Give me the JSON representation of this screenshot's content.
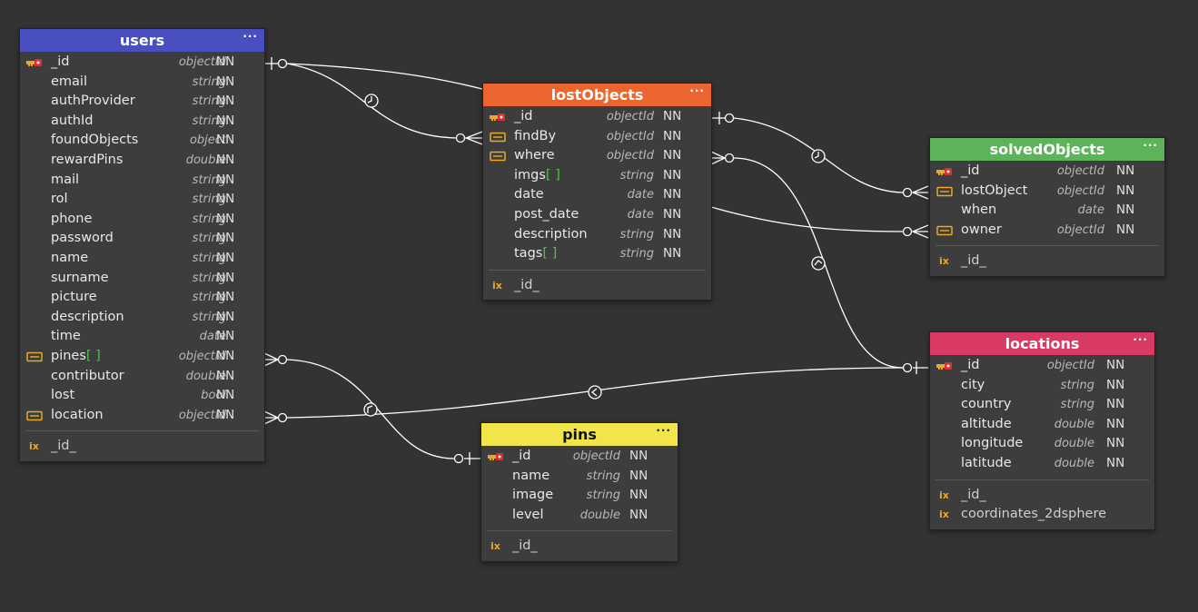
{
  "colors": {
    "users": "#4a4fc0",
    "lostObjects": "#ec6530",
    "solvedObjects": "#5cb35a",
    "locations": "#d83a63",
    "pins": "#f2e54a",
    "background": "#333333",
    "line": "#ffffff"
  },
  "menu_label": "···",
  "tables": {
    "users": {
      "title": "users",
      "fields": [
        {
          "name": "_id",
          "type": "objectId",
          "nn": "NN",
          "icon": "pk-icon"
        },
        {
          "name": "email",
          "type": "string",
          "nn": "NN",
          "icon": ""
        },
        {
          "name": "authProvider",
          "type": "string",
          "nn": "NN",
          "icon": ""
        },
        {
          "name": "authId",
          "type": "string",
          "nn": "NN",
          "icon": ""
        },
        {
          "name": "foundObjects",
          "type": "object",
          "nn": "NN",
          "icon": ""
        },
        {
          "name": "rewardPins",
          "type": "double",
          "nn": "NN",
          "icon": ""
        },
        {
          "name": "mail",
          "type": "string",
          "nn": "NN",
          "icon": ""
        },
        {
          "name": "rol",
          "type": "string",
          "nn": "NN",
          "icon": ""
        },
        {
          "name": "phone",
          "type": "string",
          "nn": "NN",
          "icon": ""
        },
        {
          "name": "password",
          "type": "string",
          "nn": "NN",
          "icon": ""
        },
        {
          "name": "name",
          "type": "string",
          "nn": "NN",
          "icon": ""
        },
        {
          "name": "surname",
          "type": "string",
          "nn": "NN",
          "icon": ""
        },
        {
          "name": "picture",
          "type": "string",
          "nn": "NN",
          "icon": ""
        },
        {
          "name": "description",
          "type": "string",
          "nn": "NN",
          "icon": ""
        },
        {
          "name": "time",
          "type": "date",
          "nn": "NN",
          "icon": ""
        },
        {
          "name": "pines",
          "array": "[ ]",
          "type": "objectId",
          "nn": "NN",
          "icon": "fk-icon"
        },
        {
          "name": "contributor",
          "type": "double",
          "nn": "NN",
          "icon": ""
        },
        {
          "name": "lost",
          "type": "bool",
          "nn": "NN",
          "icon": ""
        },
        {
          "name": "location",
          "type": "objectId",
          "nn": "NN",
          "icon": "fk-icon"
        }
      ],
      "indexes": [
        {
          "label": "ix",
          "name": "_id_"
        }
      ]
    },
    "lostObjects": {
      "title": "lostObjects",
      "fields": [
        {
          "name": "_id",
          "type": "objectId",
          "nn": "NN",
          "icon": "pk-icon"
        },
        {
          "name": "findBy",
          "type": "objectId",
          "nn": "NN",
          "icon": "fk-icon"
        },
        {
          "name": "where",
          "type": "objectId",
          "nn": "NN",
          "icon": "fk-icon"
        },
        {
          "name": "imgs",
          "array": "[ ]",
          "type": "string",
          "nn": "NN",
          "icon": ""
        },
        {
          "name": "date",
          "type": "date",
          "nn": "NN",
          "icon": ""
        },
        {
          "name": "post_date",
          "type": "date",
          "nn": "NN",
          "icon": ""
        },
        {
          "name": "description",
          "type": "string",
          "nn": "NN",
          "icon": ""
        },
        {
          "name": "tags",
          "array": "[ ]",
          "type": "string",
          "nn": "NN",
          "icon": ""
        }
      ],
      "indexes": [
        {
          "label": "ix",
          "name": "_id_"
        }
      ]
    },
    "solvedObjects": {
      "title": "solvedObjects",
      "fields": [
        {
          "name": "_id",
          "type": "objectId",
          "nn": "NN",
          "icon": "pk-icon"
        },
        {
          "name": "lostObject",
          "type": "objectId",
          "nn": "NN",
          "icon": "fk-icon"
        },
        {
          "name": "when",
          "type": "date",
          "nn": "NN",
          "icon": ""
        },
        {
          "name": "owner",
          "type": "objectId",
          "nn": "NN",
          "icon": "fk-icon"
        }
      ],
      "indexes": [
        {
          "label": "ix",
          "name": "_id_"
        }
      ]
    },
    "locations": {
      "title": "locations",
      "fields": [
        {
          "name": "_id",
          "type": "objectId",
          "nn": "NN",
          "icon": "pk-icon"
        },
        {
          "name": "city",
          "type": "string",
          "nn": "NN",
          "icon": ""
        },
        {
          "name": "country",
          "type": "string",
          "nn": "NN",
          "icon": ""
        },
        {
          "name": "altitude",
          "type": "double",
          "nn": "NN",
          "icon": ""
        },
        {
          "name": "longitude",
          "type": "double",
          "nn": "NN",
          "icon": ""
        },
        {
          "name": "latitude",
          "type": "double",
          "nn": "NN",
          "icon": ""
        }
      ],
      "indexes": [
        {
          "label": "ix",
          "name": "_id_"
        },
        {
          "label": "ix",
          "name": "coordinates_2dsphere"
        }
      ]
    },
    "pins": {
      "title": "pins",
      "fields": [
        {
          "name": "_id",
          "type": "objectId",
          "nn": "NN",
          "icon": "pk-icon"
        },
        {
          "name": "name",
          "type": "string",
          "nn": "NN",
          "icon": ""
        },
        {
          "name": "image",
          "type": "string",
          "nn": "NN",
          "icon": ""
        },
        {
          "name": "level",
          "type": "double",
          "nn": "NN",
          "icon": ""
        }
      ],
      "indexes": [
        {
          "label": "ix",
          "name": "_id_"
        }
      ]
    }
  }
}
